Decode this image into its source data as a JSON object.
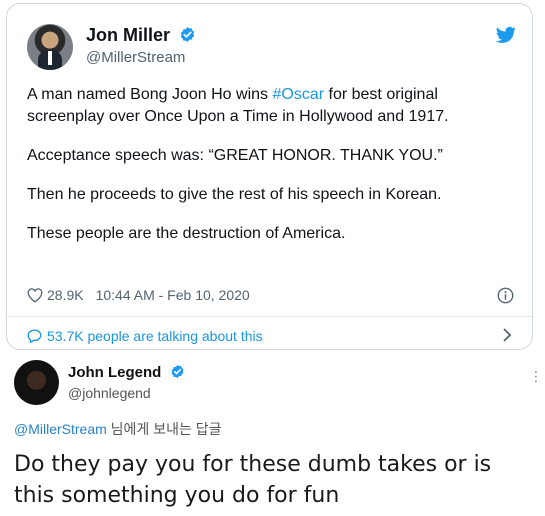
{
  "tweet": {
    "author_name": "Jon Miller",
    "author_handle": "@MillerStream",
    "lines": [
      {
        "before": "A man named Bong Joon Ho wins ",
        "hashtag": "#Oscar",
        "after": " for best original screenplay over Once Upon a Time in Hollywood and 1917."
      },
      {
        "text": "Acceptance speech was: “GREAT HONOR. THANK YOU.”"
      },
      {
        "text": "Then he proceeds to give the rest of his speech in Korean."
      },
      {
        "text": "These people are the destruction of America."
      }
    ],
    "likes": "28.9K",
    "timestamp": "10:44 AM - Feb 10, 2020",
    "talking": "53.7K people are talking about this"
  },
  "reply": {
    "author_name": "John Legend",
    "author_handle": "@johnlegend",
    "more": "⋮",
    "replying_mention": "@MillerStream",
    "replying_suffix": " 님에게 보내는 답글",
    "text": "Do they pay you for these dumb takes or is this something you do for fun"
  },
  "colors": {
    "verified": "#1d9bf0",
    "link": "#1b95e0",
    "twitter_blue": "#1d9bf0"
  },
  "icons": [
    "verified-badge-icon",
    "twitter-bird-icon",
    "heart-icon",
    "info-icon",
    "speech-bubble-icon",
    "chevron-right-icon"
  ]
}
